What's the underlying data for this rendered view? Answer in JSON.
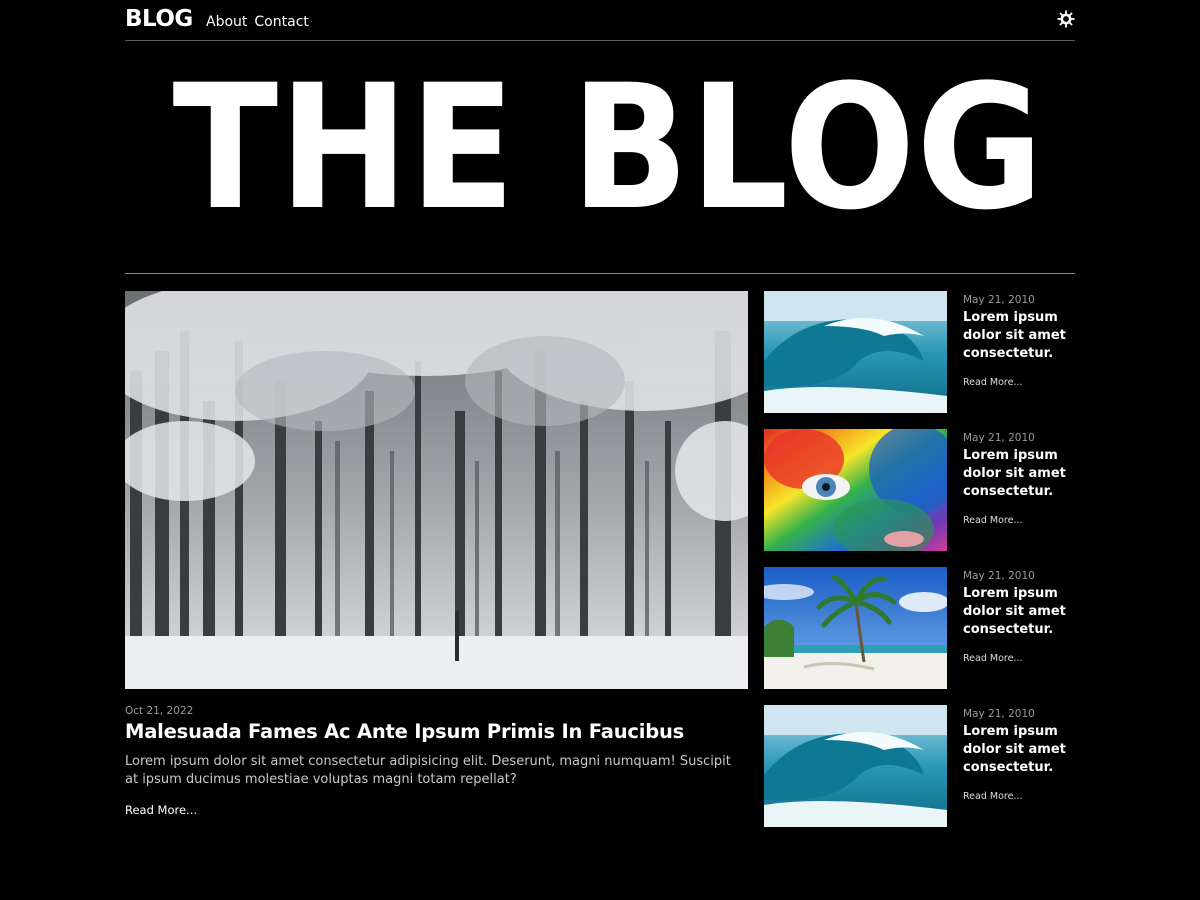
{
  "nav": {
    "brand": "BLOG",
    "links": [
      {
        "label": "About"
      },
      {
        "label": "Contact"
      }
    ],
    "theme_icon": "gear-sun-icon"
  },
  "hero": {
    "title": "THE BLOG"
  },
  "featured": {
    "image": "snowy-forest-image",
    "date": "Oct 21, 2022",
    "title": "Malesuada Fames Ac Ante Ipsum Primis In Faucibus",
    "excerpt": "Lorem ipsum dolor sit amet consectetur adipisicing elit. Deserunt, magni numquam! Suscipit at ipsum ducimus molestiae voluptas magni totam repellat?",
    "read_more": "Read More..."
  },
  "posts": [
    {
      "image": "ocean-wave-image",
      "date": "May 21, 2010",
      "title": "Lorem ipsum dolor sit amet consectetur.",
      "read_more": "Read More..."
    },
    {
      "image": "rainbow-face-image",
      "date": "May 21, 2010",
      "title": "Lorem ipsum dolor sit amet consectetur.",
      "read_more": "Read More..."
    },
    {
      "image": "beach-palm-image",
      "date": "May 21, 2010",
      "title": "Lorem ipsum dolor sit amet consectetur.",
      "read_more": "Read More..."
    },
    {
      "image": "ocean-wave-image",
      "date": "May 21, 2010",
      "title": "Lorem ipsum dolor sit amet consectetur.",
      "read_more": "Read More..."
    }
  ],
  "colors": {
    "background": "#000000",
    "text": "#ffffff",
    "muted": "#9a9a9a",
    "rule": "#8a8a8a"
  }
}
